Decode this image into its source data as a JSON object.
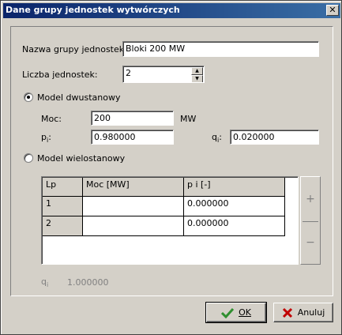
{
  "window": {
    "title": "Dane grupy jednostek wytwórczych",
    "close_glyph": "✕"
  },
  "form": {
    "group_name_label": "Nazwa grupy jednostek :",
    "group_name_value": "Bloki 200 MW",
    "unit_count_label": "Liczba jednostek:",
    "unit_count_value": "2"
  },
  "model_two_state": {
    "label": "Model dwustanowy",
    "selected": true,
    "power_label": "Moc:",
    "power_value": "200",
    "power_unit": "MW",
    "p_label": "p",
    "p_sub": "i",
    "p_colon": ":",
    "p_value": "0.980000",
    "q_label": "q",
    "q_sub": "i",
    "q_colon": ":",
    "q_value": "0.020000"
  },
  "model_multi_state": {
    "label": "Model wielostanowy",
    "selected": false,
    "table": {
      "headers": [
        "Lp",
        "Moc [MW]",
        "p i  [-]"
      ],
      "rows": [
        {
          "lp": "1",
          "moc": "",
          "p": "0.000000"
        },
        {
          "lp": "2",
          "moc": "",
          "p": "0.000000"
        }
      ]
    },
    "add_glyph": "+",
    "remove_glyph": "−",
    "q_summary_label": "q",
    "q_summary_sub": "i",
    "q_summary_value": "1.000000"
  },
  "buttons": {
    "ok": "OK",
    "cancel": "Anuluj"
  },
  "colors": {
    "title_start": "#0a246a",
    "title_end": "#3a6ea5",
    "face": "#d4d0c8",
    "ok_check": "#2f8f2f",
    "cancel_x": "#c00000"
  }
}
